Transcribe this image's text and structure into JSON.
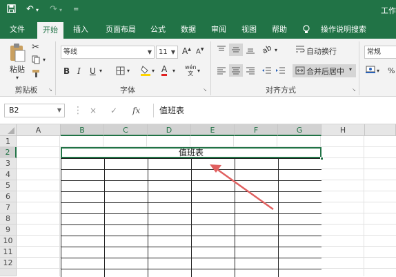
{
  "app": {
    "title": "工作"
  },
  "quick_access": {
    "save_icon": "save-icon",
    "undo_icon": "undo-icon",
    "redo_icon": "redo-icon",
    "customize": "="
  },
  "tabs": [
    "文件",
    "开始",
    "插入",
    "页面布局",
    "公式",
    "数据",
    "审阅",
    "视图",
    "帮助",
    "操作说明搜索"
  ],
  "active_tab": "开始",
  "ribbon": {
    "clipboard": {
      "paste_label": "粘贴",
      "group_label": "剪贴板"
    },
    "font": {
      "font_name": "等线",
      "font_size": "11",
      "bold": "B",
      "italic": "I",
      "underline": "U",
      "grow": "A",
      "shrink": "A",
      "font_color": "A",
      "phonetic": "wén",
      "group_label": "字体"
    },
    "alignment": {
      "wrap_text": "自动换行",
      "merge_center": "合并后居中",
      "group_label": "对齐方式"
    },
    "number": {
      "format": "常规",
      "currency": "$"
    }
  },
  "formula_bar": {
    "name_box": "B2",
    "cancel": "×",
    "confirm": "✓",
    "fx": "fx",
    "value": "值班表"
  },
  "columns": [
    "A",
    "B",
    "C",
    "D",
    "E",
    "F",
    "G",
    "H"
  ],
  "rows": [
    "1",
    "2",
    "3",
    "4",
    "5",
    "6",
    "7",
    "8",
    "9",
    "10",
    "11",
    "12"
  ],
  "selected_cell": "B2",
  "merged_cell_text": "值班表",
  "colors": {
    "brand": "#217346",
    "arrow": "#e06060"
  }
}
